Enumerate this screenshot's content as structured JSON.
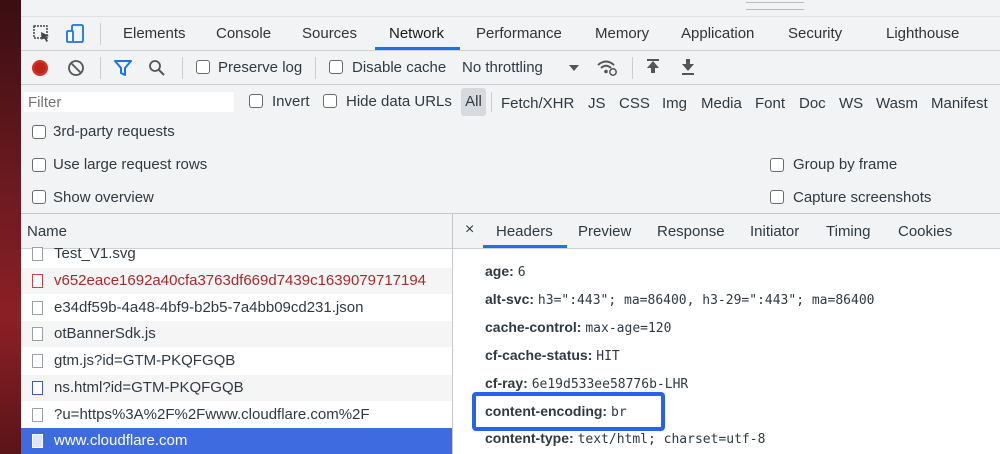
{
  "main_tabs": [
    "Elements",
    "Console",
    "Sources",
    "Network",
    "Performance",
    "Memory",
    "Application",
    "Security",
    "Lighthouse"
  ],
  "active_tab": "Network",
  "toolbar": {
    "preserve_log": "Preserve log",
    "disable_cache": "Disable cache",
    "throttling": "No throttling"
  },
  "filter": {
    "placeholder": "Filter",
    "invert": "Invert",
    "hide_data_urls": "Hide data URLs",
    "types": [
      "All",
      "Fetch/XHR",
      "JS",
      "CSS",
      "Img",
      "Media",
      "Font",
      "Doc",
      "WS",
      "Wasm",
      "Manifest"
    ],
    "third_party": "3rd-party requests"
  },
  "settings": {
    "large_rows": "Use large request rows",
    "show_overview": "Show overview",
    "group_by_frame": "Group by frame",
    "capture_screenshots": "Capture screenshots"
  },
  "request_list": {
    "header": "Name",
    "rows": [
      {
        "name": "Test_V1.svg",
        "color": "#303942"
      },
      {
        "name": "v652eace1692a40cfa3763df669d7439c1639079717194",
        "color": "#a52a2a"
      },
      {
        "name": "e34df59b-4a48-4bf9-b2b5-7a4bb09cd231.json",
        "color": "#303942"
      },
      {
        "name": "otBannerSdk.js",
        "color": "#303942"
      },
      {
        "name": "gtm.js?id=GTM-PKQFGQB",
        "color": "#303942"
      },
      {
        "name": "ns.html?id=GTM-PKQFGQB",
        "color": "#303942"
      },
      {
        "name": "?u=https%3A%2F%2Fwww.cloudflare.com%2F",
        "color": "#303942"
      },
      {
        "name": "www.cloudflare.com",
        "color": "#ffffff"
      }
    ]
  },
  "details": {
    "close": "×",
    "tabs": [
      "Headers",
      "Preview",
      "Response",
      "Initiator",
      "Timing",
      "Cookies"
    ],
    "active_tab": "Headers",
    "headers": [
      {
        "key": "age:",
        "value": "6"
      },
      {
        "key": "alt-svc:",
        "value": "h3=\":443\"; ma=86400, h3-29=\":443\"; ma=86400"
      },
      {
        "key": "cache-control:",
        "value": "max-age=120"
      },
      {
        "key": "cf-cache-status:",
        "value": "HIT"
      },
      {
        "key": "cf-ray:",
        "value": "6e19d533ee58776b-LHR"
      },
      {
        "key": "content-encoding:",
        "value": "br"
      },
      {
        "key": "content-type:",
        "value": "text/html; charset=utf-8"
      }
    ]
  },
  "colors": {
    "accent": "#1a73e8",
    "selected_row": "#3f6be0",
    "highlight_box": "#2563eb"
  }
}
